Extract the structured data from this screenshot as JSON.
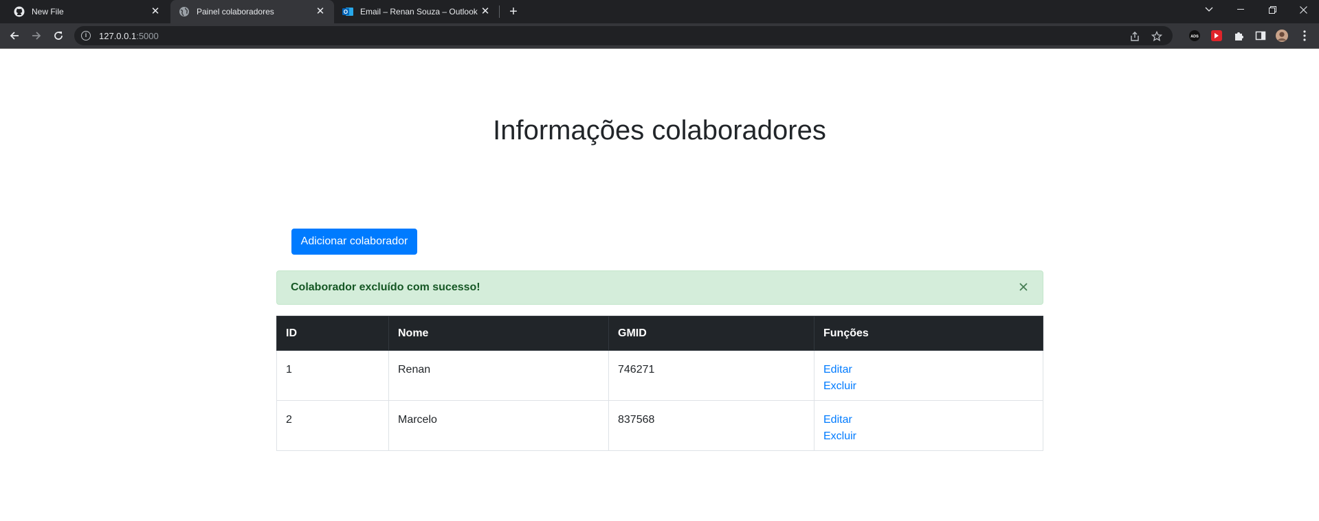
{
  "browser": {
    "tabs": [
      {
        "title": "New File",
        "icon": "github-icon",
        "active": false
      },
      {
        "title": "Painel colaboradores",
        "icon": "globe-icon",
        "active": true
      },
      {
        "title": "Email – Renan Souza – Outlook",
        "icon": "outlook-icon",
        "active": false
      }
    ],
    "url_host": "127.0.0.1",
    "url_port": ":5000"
  },
  "page": {
    "title": "Informações colaboradores",
    "add_button": "Adicionar colaborador",
    "alert": "Colaborador excluído com sucesso!",
    "table": {
      "headers": [
        "ID",
        "Nome",
        "GMID",
        "Funções"
      ],
      "rows": [
        {
          "id": "1",
          "nome": "Renan",
          "gmid": "746271",
          "edit": "Editar",
          "delete": "Excluir"
        },
        {
          "id": "2",
          "nome": "Marcelo",
          "gmid": "837568",
          "edit": "Editar",
          "delete": "Excluir"
        }
      ]
    }
  },
  "colors": {
    "primary": "#007bff",
    "success_bg": "#d4edda",
    "success_text": "#155724",
    "table_head": "#212529"
  }
}
